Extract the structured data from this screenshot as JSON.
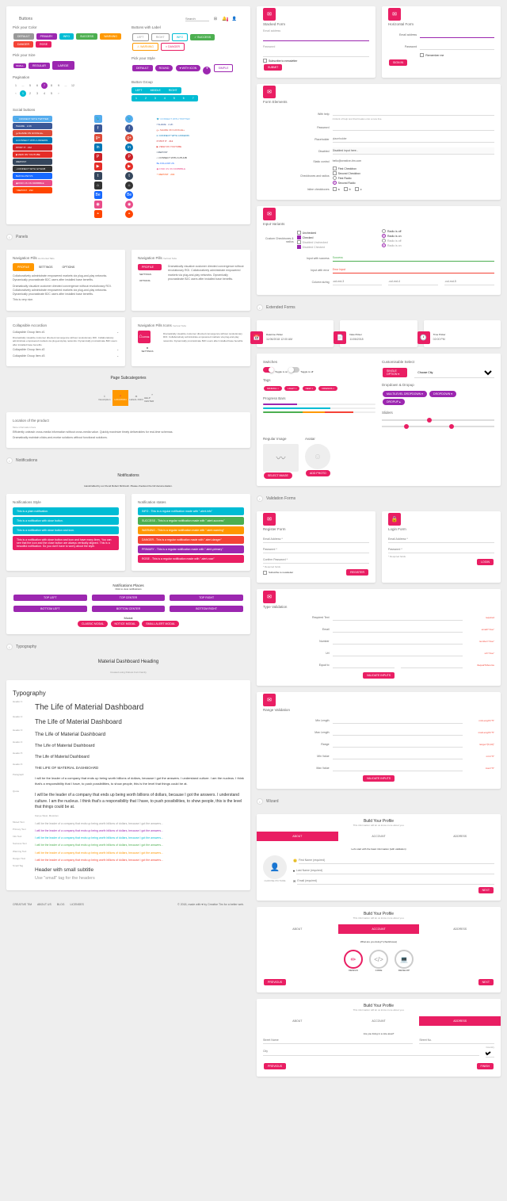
{
  "topbar": {
    "title": "Buttons",
    "search": "Search",
    "notif_count": "5"
  },
  "buttons": {
    "color_hd": "Pick your Color",
    "labels_hd": "Buttons with Label",
    "size_hd": "Pick your Size",
    "style_hd": "Pick your Style",
    "pag_hd": "Pagination",
    "grp_hd": "Button Group",
    "social_hd": "Social buttons",
    "default": "DEFAULT",
    "primary": "PRIMARY",
    "info": "INFO",
    "success": "SUCCESS",
    "warning": "WARNING",
    "danger": "DANGER",
    "rose": "ROSE",
    "left": "LEFT",
    "right": "RIGHT",
    "info_l": "INFO",
    "with_icon": "WITH ICON",
    "small": "SMALL",
    "regular": "REGULAR",
    "large": "LARGE",
    "round": "ROUND",
    "middle": "MIDDLE",
    "tw": "CONNECT WITH TWITTER",
    "fb": "SHARE · 2.2K",
    "gp": "SHARE ON GOOGLE+",
    "li": "CONNECT WITH LINKEDIN",
    "pin": "PINT IT · 212",
    "yt": "VIEW ON YOUTUBE",
    "tum": "REPOST",
    "gh": "CONNECT WITH GITHUB",
    "be": "FOLLOW US",
    "drib": "FIND US ON DRIBBBLE",
    "red": "REPOST · 232",
    "tw_s": "CONNECT WITH TWITTER",
    "fb_s": "SHARE · 2.2K",
    "gp_s": "SHARE ON GOOGLE+",
    "li_s": "CONNECT WITH LINKEDIN",
    "pin_s": "PINT IT · 212",
    "yt_s": "VIEW ON YOUTUBE",
    "tum_s": "REPOST",
    "gh_s": "CONNECT WITH GITHUB",
    "be_s": "FOLLOW US",
    "drib_s": "FIND US ON DRIBBBLE",
    "red_s": "REPOST · 232"
  },
  "forms": {
    "stacked_hd": "Stacked Form",
    "horiz_hd": "Horizontal Form",
    "elements_hd": "Form Elements",
    "variants_hd": "Input Variants",
    "email": "Email address",
    "password": "Password",
    "subscribe": "Subscribe to newsletter",
    "submit": "SUBMIT",
    "signin": "SIGN IN",
    "remember": "Remember me",
    "with_help": "With help",
    "helper": "A block of help text that breaks onto a new line.",
    "placeholder": "Placeholder",
    "placeholder_ph": "placeholder",
    "disabled": "Disabled",
    "disabled_val": "Disabled input here..",
    "static": "Static control",
    "static_val": "hello@creative-tim.com",
    "chk_rd": "Checkboxes and radios",
    "first": "First Checkbox",
    "second": "Second Checkbox",
    "r1": "First Radio",
    "r2": "Second Radio",
    "inline": "Inline checkboxes",
    "a": "a",
    "b": "b",
    "c": "c",
    "custom_chk": "Custom Checkboxes & radios",
    "unchecked": "Unchecked",
    "checked": "Checked",
    "dis_unchk": "Disabled Unchecked",
    "dis_chk": "Disabled Checked",
    "radio_off": "Radio is off",
    "radio_on": "Radio is on",
    "success_lbl": "Input with success",
    "success_val": "Success",
    "error_lbl": "Input with error",
    "error_val": "Error Input",
    "col_lbl": "Column sizing"
  },
  "panels": {
    "hd": "Panels",
    "nav1": "Navigation Pills",
    "nav1_sub": "Horizontal Tabs",
    "nav2": "Navigation Pills",
    "nav2_sub": "Vertical Tabs",
    "coll": "Collapsible Accordion",
    "nav3": "Navigation Pills Icons",
    "nav3_sub": "Vertical Tabs",
    "profile": "PROFILE",
    "settings": "SETTINGS",
    "options": "OPTIONS",
    "home": "HOME",
    "t1": "Collaboratively administrate empowered markets via plug-and-play networks. Dynamically procrastinate B2C users after installed base benefits.",
    "t2": "Dramatically visualize customer directed convergence without revolutionary ROI. Collaboratively administrate empowered markets via plug-and-play networks. Dynamically procrastinate B2C users after installed base benefits.",
    "t3": "This is very nice.",
    "coll1": "Collapsible Group Item #1",
    "coll2": "Collapsible Group Item #2",
    "coll3": "Collapsible Group Item #3",
    "subcat": "Page Subcategories",
    "desc": "Description",
    "loc_hd": "Location of the product",
    "loc_sub": "More information here",
    "loc1": "Efficiently unleash cross-media information without cross-media value. Quickly maximize timely deliverables for real-time schemas.",
    "loc2": "Dramatically maintain clicks-and-mortar solutions without functional solutions."
  },
  "ext": {
    "hd": "Extended Forms",
    "dt": "Datetime Picker",
    "dt_val": "11/06/2018 12:00 AM",
    "dp": "Date Picker",
    "dp_val": "11/06/2018",
    "tp": "Time Picker",
    "tp_val": "02:00 PM",
    "sw": "Switches",
    "on": "Toggle is on",
    "off": "Toggle is off",
    "cust": "Customisable Select",
    "single": "SINGLE OPTION",
    "choose": "Choose City",
    "tags": "Tags",
    "tag1": "MINIMAL",
    "tag2": "LIGHT",
    "tag3": "NEW",
    "tag4": "FRIENDS",
    "drop": "Dropdown & Dropup",
    "multi": "MULTILEVEL DROPDOWN",
    "dropdown": "DROPDOWN",
    "dropup": "DROPUP",
    "prog": "Progress Bars",
    "sliders": "Sliders",
    "regimg": "Regular Image",
    "avatar": "Avatar",
    "selimg": "SELECT IMAGE",
    "addphoto": "ADD PHOTO"
  },
  "valid": {
    "hd": "Validation Forms",
    "reg": "Register Form",
    "login": "Login Form",
    "email_req": "Email Address *",
    "pwd_req": "Password *",
    "pwd_conf": "Confirm Password *",
    "req": "* Required fields",
    "subscribe": "Subscribe to newsletter",
    "register": "REGISTER",
    "login_btn": "LOGIN",
    "type": "Type Validation",
    "range": "Range Validation",
    "required": "Required Text",
    "req_err": "required",
    "email_lbl": "Email",
    "email_err": "email=\"true\"",
    "number": "Number",
    "num_err": "number=\"true\"",
    "url": "Url",
    "url_err": "url=\"true\"",
    "equal": "Equal to",
    "eq_err": "#equalToSource",
    "minlen": "Min Length",
    "minlen_err": "minLength=\"5\"",
    "maxlen": "Max Length",
    "maxlen_err": "maxLength=\"5\"",
    "rng": "Range",
    "rng_err": "range=\"[6,10]\"",
    "minval": "Min Value",
    "minval_err": "min=\"6\"",
    "maxval": "Max Value",
    "maxval_err": "max=\"6\"",
    "validate": "VALIDATE INPUTS"
  },
  "notif": {
    "hd": "Notifications",
    "sub": "Notifications",
    "desc": "Handcrafted by our friend Robert McIntosh. Please checkout the full documentation.",
    "style_hd": "Notifications Style",
    "state_hd": "Notification states",
    "n1": "This is a plain notification.",
    "n2": "This is a notification with close button.",
    "n3": "This is a notification with close button and icon.",
    "n4": "This is a notification with close button and icon and have many lines. You can see that the icon and the close button are always vertically aligned. This is a beautiful notification. So you don't have to worry about the style.",
    "info_msg": "INFO - This is a regular notification made with \".alert-info\"",
    "success_msg": "SUCCESS - This is a regular notification made with \".alert-success\"",
    "warning_msg": "WARNING - This is a regular notification made with \".alert-warning\"",
    "danger_msg": "DANGER - This is a regular notification made with \".alert-danger\"",
    "primary_msg": "PRIMARY - This is a regular notification made with \".alert-primary\"",
    "rose_msg": "ROSE - This is a regular notification made with \".alert-rose\"",
    "places": "Notifications Places",
    "places_sub": "Click to view notifications",
    "tl": "TOP LEFT",
    "tc": "TOP CENTER",
    "tr": "TOP RIGHT",
    "bl": "BOTTOM LEFT",
    "bc": "BOTTOM CENTER",
    "br": "BOTTOM RIGHT",
    "modal": "Modal",
    "classic": "CLASSIC MODAL",
    "notice": "NOTICE MODAL",
    "small": "SMALL ALERT MODAL"
  },
  "typo": {
    "hd": "Typography",
    "heading": "Material Dashboard Heading",
    "sub": "Created using Roboto Font Family",
    "title": "Typography",
    "life": "The Life of Material Dashboard",
    "lbl_h1": "Header 1",
    "lbl_h2": "Header 2",
    "lbl_h3": "Header 3",
    "lbl_h4": "Header 4",
    "lbl_h5": "Header 5",
    "lbl_h6": "Header 6",
    "lbl_p": "Paragraph",
    "lbl_q": "Quote",
    "lbl_m": "Muted Text",
    "lbl_pr": "Primary Text",
    "lbl_i": "Info Text",
    "lbl_s": "Success Text",
    "lbl_w": "Warning Text",
    "lbl_d": "Danger Text",
    "lbl_sm": "Small Tag",
    "h6": "THE LIFE OF MATERIAL DASHBOARD",
    "para": "I will be the leader of a company that ends up being worth billions of dollars, because I got the answers. I understand culture. I am the nucleus. I think that's a responsibility that I have, to push possibilities, to show people, this is the level that things could be at.",
    "quote": "I will be the leader of a company that ends up being worth billions of dollars, because I got the answers. I understand culture. I am the nucleus. I think that's a responsibility that I have, to push possibilities, to show people, this is the level that things could be at.",
    "author": "Kanye West, Musician",
    "muted": "I will be the leader of a company that ends up being worth billions of dollars, because I got the answers...",
    "colored": "I will be the leader of a company that ends up being worth billions of dollars, because I got the answers...",
    "small_hd": "Header with small subtitle",
    "small_sub": "Use \"small\" tag for the headers"
  },
  "wizard": {
    "hd": "Wizard",
    "title": "Build Your Profile",
    "sub": "This information will let us know more about you.",
    "about": "ABOUT",
    "account": "ACCOUNT",
    "address": "ADDRESS",
    "s1": "Let's start with the basic information (with validation)",
    "s2": "What are you doing? (checkboxes)",
    "s3": "Are you living in a nice area?",
    "first": "First Name (required)",
    "last": "Last Name (required)",
    "email": "Email (required)",
    "choose": "CHOOSE PICTURE",
    "design": "DESIGN",
    "code": "CODE",
    "develop": "DEVELOP",
    "street": "Street Name",
    "no": "Street No.",
    "city": "City",
    "country": "Country",
    "country_sel": "SINGLE SELECT",
    "next": "NEXT",
    "prev": "PREVIOUS",
    "finish": "FINISH"
  },
  "footer": {
    "l1": "CREATIVE TIM",
    "l2": "ABOUT US",
    "l3": "BLOG",
    "l4": "LICENSES",
    "copy": "© 2018, made with ♥ by Creative Tim for a better web."
  }
}
